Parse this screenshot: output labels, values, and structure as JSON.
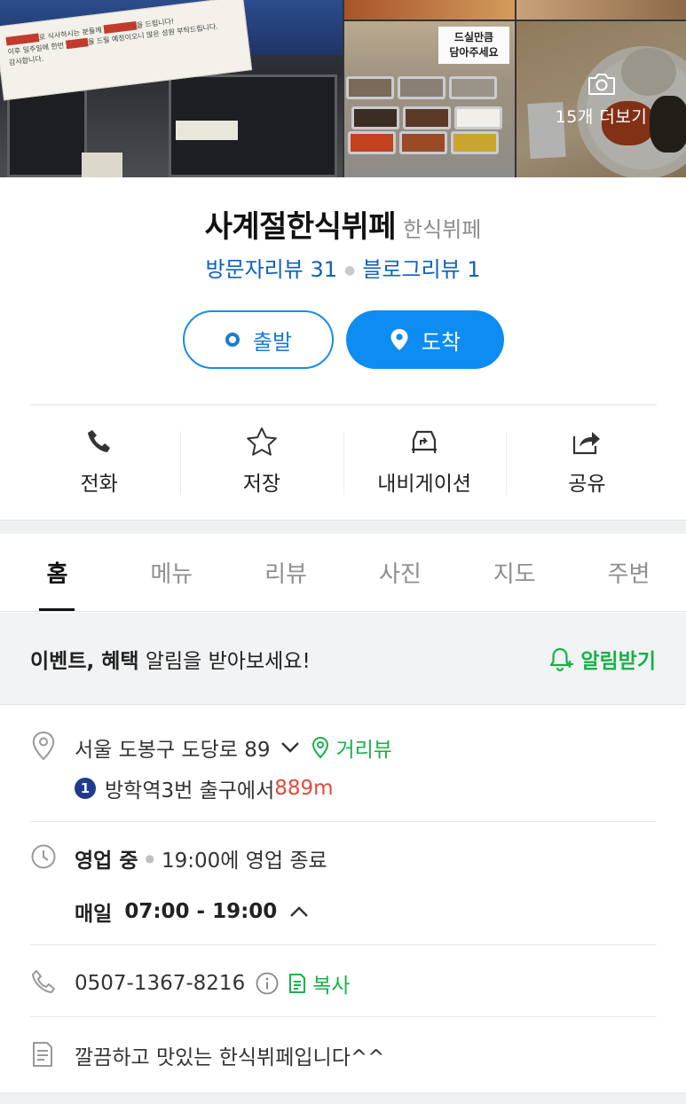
{
  "photos": {
    "more_label": "15개 더보기",
    "buffet_sign": "드실만큼\n담아주세요"
  },
  "place": {
    "name": "사계절한식뷔페",
    "category": "한식뷔페",
    "visitor_reviews": "방문자리뷰 31",
    "blog_reviews": "블로그리뷰 1"
  },
  "route": {
    "start_label": "출발",
    "arrive_label": "도착"
  },
  "actions": [
    {
      "label": "전화",
      "icon": "phone-icon"
    },
    {
      "label": "저장",
      "icon": "star-icon"
    },
    {
      "label": "내비게이션",
      "icon": "car-navigation-icon"
    },
    {
      "label": "공유",
      "icon": "share-icon"
    }
  ],
  "tabs": [
    {
      "label": "홈",
      "active": true
    },
    {
      "label": "메뉴",
      "active": false
    },
    {
      "label": "리뷰",
      "active": false
    },
    {
      "label": "사진",
      "active": false
    },
    {
      "label": "지도",
      "active": false
    },
    {
      "label": "주변",
      "active": false
    }
  ],
  "notify": {
    "bold_text": "이벤트, 혜택",
    "text": " 알림을 받아보세요!",
    "button_label": "알림받기"
  },
  "address": {
    "text": "서울 도봉구 도당로 89",
    "street_view_label": "거리뷰",
    "station_number": "1",
    "station_name": "방학역",
    "station_exit": " 3번 출구에서 ",
    "distance": "889m"
  },
  "hours": {
    "status": "영업 중",
    "close_text": "19:00에 영업 종료",
    "day_label": "매일",
    "time_range": "07:00 - 19:00"
  },
  "phone": {
    "number": "0507-1367-8216",
    "copy_label": "복사"
  },
  "description": {
    "text": "깔끔하고 맛있는 한식뷔페입니다^^"
  },
  "colors": {
    "brand_blue": "#0d8cf2",
    "review_blue": "#0f62b8",
    "green": "#19b04a",
    "distance_red": "#e04a3e"
  }
}
